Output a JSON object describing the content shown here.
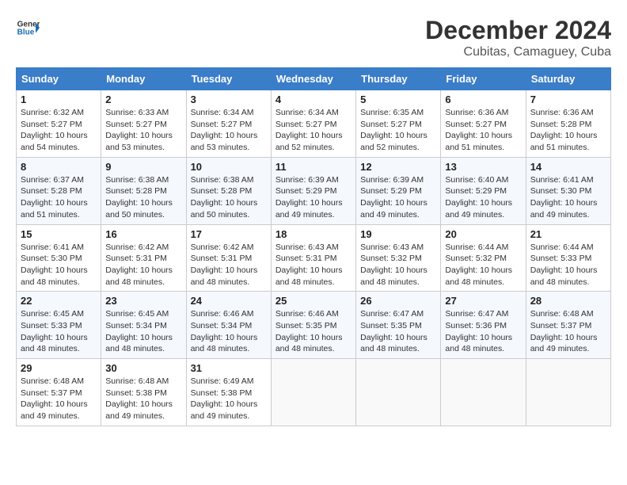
{
  "header": {
    "logo_line1": "General",
    "logo_line2": "Blue",
    "month": "December 2024",
    "location": "Cubitas, Camaguey, Cuba"
  },
  "weekdays": [
    "Sunday",
    "Monday",
    "Tuesday",
    "Wednesday",
    "Thursday",
    "Friday",
    "Saturday"
  ],
  "weeks": [
    [
      {
        "day": "1",
        "sunrise": "Sunrise: 6:32 AM",
        "sunset": "Sunset: 5:27 PM",
        "daylight": "Daylight: 10 hours and 54 minutes."
      },
      {
        "day": "2",
        "sunrise": "Sunrise: 6:33 AM",
        "sunset": "Sunset: 5:27 PM",
        "daylight": "Daylight: 10 hours and 53 minutes."
      },
      {
        "day": "3",
        "sunrise": "Sunrise: 6:34 AM",
        "sunset": "Sunset: 5:27 PM",
        "daylight": "Daylight: 10 hours and 53 minutes."
      },
      {
        "day": "4",
        "sunrise": "Sunrise: 6:34 AM",
        "sunset": "Sunset: 5:27 PM",
        "daylight": "Daylight: 10 hours and 52 minutes."
      },
      {
        "day": "5",
        "sunrise": "Sunrise: 6:35 AM",
        "sunset": "Sunset: 5:27 PM",
        "daylight": "Daylight: 10 hours and 52 minutes."
      },
      {
        "day": "6",
        "sunrise": "Sunrise: 6:36 AM",
        "sunset": "Sunset: 5:27 PM",
        "daylight": "Daylight: 10 hours and 51 minutes."
      },
      {
        "day": "7",
        "sunrise": "Sunrise: 6:36 AM",
        "sunset": "Sunset: 5:28 PM",
        "daylight": "Daylight: 10 hours and 51 minutes."
      }
    ],
    [
      {
        "day": "8",
        "sunrise": "Sunrise: 6:37 AM",
        "sunset": "Sunset: 5:28 PM",
        "daylight": "Daylight: 10 hours and 51 minutes."
      },
      {
        "day": "9",
        "sunrise": "Sunrise: 6:38 AM",
        "sunset": "Sunset: 5:28 PM",
        "daylight": "Daylight: 10 hours and 50 minutes."
      },
      {
        "day": "10",
        "sunrise": "Sunrise: 6:38 AM",
        "sunset": "Sunset: 5:28 PM",
        "daylight": "Daylight: 10 hours and 50 minutes."
      },
      {
        "day": "11",
        "sunrise": "Sunrise: 6:39 AM",
        "sunset": "Sunset: 5:29 PM",
        "daylight": "Daylight: 10 hours and 49 minutes."
      },
      {
        "day": "12",
        "sunrise": "Sunrise: 6:39 AM",
        "sunset": "Sunset: 5:29 PM",
        "daylight": "Daylight: 10 hours and 49 minutes."
      },
      {
        "day": "13",
        "sunrise": "Sunrise: 6:40 AM",
        "sunset": "Sunset: 5:29 PM",
        "daylight": "Daylight: 10 hours and 49 minutes."
      },
      {
        "day": "14",
        "sunrise": "Sunrise: 6:41 AM",
        "sunset": "Sunset: 5:30 PM",
        "daylight": "Daylight: 10 hours and 49 minutes."
      }
    ],
    [
      {
        "day": "15",
        "sunrise": "Sunrise: 6:41 AM",
        "sunset": "Sunset: 5:30 PM",
        "daylight": "Daylight: 10 hours and 48 minutes."
      },
      {
        "day": "16",
        "sunrise": "Sunrise: 6:42 AM",
        "sunset": "Sunset: 5:31 PM",
        "daylight": "Daylight: 10 hours and 48 minutes."
      },
      {
        "day": "17",
        "sunrise": "Sunrise: 6:42 AM",
        "sunset": "Sunset: 5:31 PM",
        "daylight": "Daylight: 10 hours and 48 minutes."
      },
      {
        "day": "18",
        "sunrise": "Sunrise: 6:43 AM",
        "sunset": "Sunset: 5:31 PM",
        "daylight": "Daylight: 10 hours and 48 minutes."
      },
      {
        "day": "19",
        "sunrise": "Sunrise: 6:43 AM",
        "sunset": "Sunset: 5:32 PM",
        "daylight": "Daylight: 10 hours and 48 minutes."
      },
      {
        "day": "20",
        "sunrise": "Sunrise: 6:44 AM",
        "sunset": "Sunset: 5:32 PM",
        "daylight": "Daylight: 10 hours and 48 minutes."
      },
      {
        "day": "21",
        "sunrise": "Sunrise: 6:44 AM",
        "sunset": "Sunset: 5:33 PM",
        "daylight": "Daylight: 10 hours and 48 minutes."
      }
    ],
    [
      {
        "day": "22",
        "sunrise": "Sunrise: 6:45 AM",
        "sunset": "Sunset: 5:33 PM",
        "daylight": "Daylight: 10 hours and 48 minutes."
      },
      {
        "day": "23",
        "sunrise": "Sunrise: 6:45 AM",
        "sunset": "Sunset: 5:34 PM",
        "daylight": "Daylight: 10 hours and 48 minutes."
      },
      {
        "day": "24",
        "sunrise": "Sunrise: 6:46 AM",
        "sunset": "Sunset: 5:34 PM",
        "daylight": "Daylight: 10 hours and 48 minutes."
      },
      {
        "day": "25",
        "sunrise": "Sunrise: 6:46 AM",
        "sunset": "Sunset: 5:35 PM",
        "daylight": "Daylight: 10 hours and 48 minutes."
      },
      {
        "day": "26",
        "sunrise": "Sunrise: 6:47 AM",
        "sunset": "Sunset: 5:35 PM",
        "daylight": "Daylight: 10 hours and 48 minutes."
      },
      {
        "day": "27",
        "sunrise": "Sunrise: 6:47 AM",
        "sunset": "Sunset: 5:36 PM",
        "daylight": "Daylight: 10 hours and 48 minutes."
      },
      {
        "day": "28",
        "sunrise": "Sunrise: 6:48 AM",
        "sunset": "Sunset: 5:37 PM",
        "daylight": "Daylight: 10 hours and 49 minutes."
      }
    ],
    [
      {
        "day": "29",
        "sunrise": "Sunrise: 6:48 AM",
        "sunset": "Sunset: 5:37 PM",
        "daylight": "Daylight: 10 hours and 49 minutes."
      },
      {
        "day": "30",
        "sunrise": "Sunrise: 6:48 AM",
        "sunset": "Sunset: 5:38 PM",
        "daylight": "Daylight: 10 hours and 49 minutes."
      },
      {
        "day": "31",
        "sunrise": "Sunrise: 6:49 AM",
        "sunset": "Sunset: 5:38 PM",
        "daylight": "Daylight: 10 hours and 49 minutes."
      },
      null,
      null,
      null,
      null
    ]
  ]
}
